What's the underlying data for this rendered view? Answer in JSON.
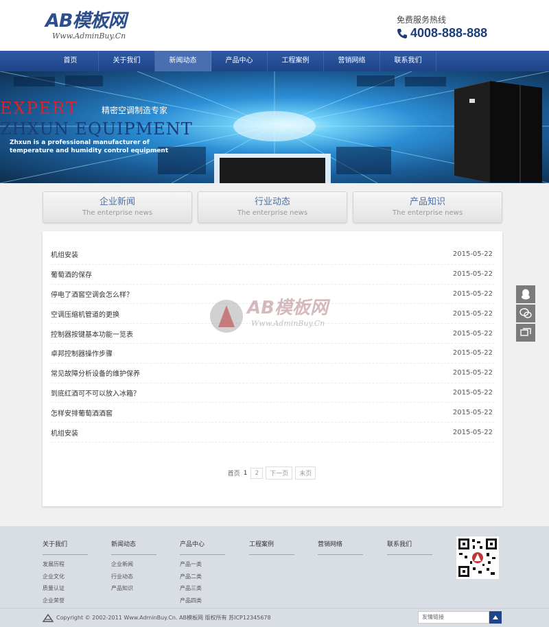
{
  "header": {
    "logo_main": "AB模板网",
    "logo_sub": "Www.AdminBuy.Cn",
    "hotline_label": "免费服务热线",
    "hotline_number": "4008-888-888"
  },
  "nav": {
    "items": [
      "首页",
      "关于我们",
      "新闻动态",
      "产品中心",
      "工程案例",
      "营销网络",
      "联系我们"
    ],
    "active_index": 2
  },
  "banner": {
    "line1": "EXPERT",
    "line1_cn": "精密空调制造专家",
    "line2": "ZHXUN EQUIPMENT",
    "line3": "Zhxun is a professional manufacturer of temperature and humidity control equipment"
  },
  "tabs": [
    {
      "title": "企业新闻",
      "subtitle": "The enterprise news"
    },
    {
      "title": "行业动态",
      "subtitle": "The enterprise news"
    },
    {
      "title": "产品知识",
      "subtitle": "The enterprise news"
    }
  ],
  "news": [
    {
      "title": "机组安装",
      "date": "2015-05-22"
    },
    {
      "title": "葡萄酒的保存",
      "date": "2015-05-22"
    },
    {
      "title": "停电了酒窖空调会怎么样？",
      "date": "2015-05-22"
    },
    {
      "title": "空调压缩机管道的更换",
      "date": "2015-05-22"
    },
    {
      "title": "控制器按键基本功能一览表",
      "date": "2015-05-22"
    },
    {
      "title": "卓邦控制器操作步骤",
      "date": "2015-05-22"
    },
    {
      "title": "常见故障分析设备的维护保养",
      "date": "2015-05-22"
    },
    {
      "title": "到底红酒可不可以放入冰箱？",
      "date": "2015-05-22"
    },
    {
      "title": "怎样安排葡萄酒酒窖",
      "date": "2015-05-22"
    },
    {
      "title": "机组安装",
      "date": "2015-05-22"
    }
  ],
  "watermark": {
    "main": "AB模板网",
    "sub": "Www.AdminBuy.Cn"
  },
  "pagination": {
    "first": "首页",
    "current": "1",
    "page2": "2",
    "next": "下一页",
    "last": "末页"
  },
  "side_tools": [
    "qq-icon",
    "wechat-icon",
    "message-icon"
  ],
  "footer": {
    "columns": [
      {
        "title": "关于我们",
        "links": [
          "发展历程",
          "企业文化",
          "质量认证",
          "企业荣誉"
        ]
      },
      {
        "title": "新闻动态",
        "links": [
          "企业新闻",
          "行业动态",
          "产品知识"
        ]
      },
      {
        "title": "产品中心",
        "links": [
          "产品一类",
          "产品二类",
          "产品三类",
          "产品四类"
        ]
      },
      {
        "title": "工程案例",
        "links": []
      },
      {
        "title": "营销网络",
        "links": []
      },
      {
        "title": "联系我们",
        "links": []
      }
    ],
    "copyright": "Copyright © 2002-2011 Www.AdminBuy.Cn. AB模板网 版权所有 苏ICP12345678",
    "friend_link_label": "友情链接"
  },
  "colors": {
    "brand": "#2c4f8c",
    "nav": "#1f4489",
    "accent_red": "#d8242a",
    "footer_bg": "#d9dde4"
  }
}
